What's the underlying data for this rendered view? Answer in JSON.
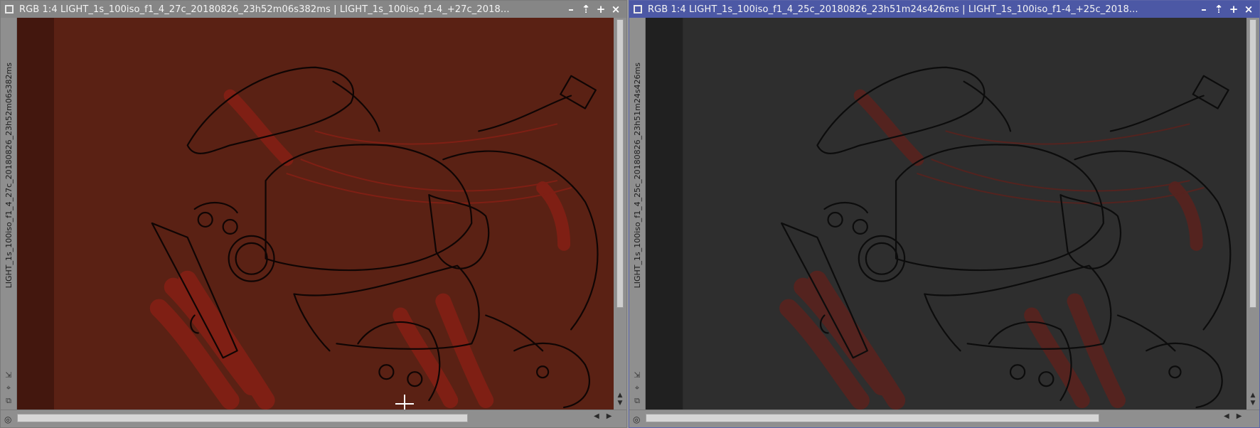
{
  "windows": [
    {
      "id": "left",
      "title": "RGB 1:4 LIGHT_1s_100iso_f1_4_27c_20180826_23h52m06s382ms | LIGHT_1s_100iso_f1-4_+27c_2018...",
      "vertical_label": "LIGHT_1s_100iso_f1_4_27c_20180826_23h52m06s382ms",
      "active": false,
      "tint": "#5a2114",
      "line_color": "#0f0504",
      "marker_color": "#8c1f14"
    },
    {
      "id": "right",
      "title": "RGB 1:4 LIGHT_1s_100iso_f1_4_25c_20180826_23h51m24s426ms | LIGHT_1s_100iso_f1-4_+25c_2018...",
      "vertical_label": "LIGHT_1s_100iso_f1_4_25c_20180826_23h51m24s426ms",
      "active": true,
      "tint": "#2e2e2e",
      "line_color": "#0c0c0c",
      "marker_color": "#6e1c16"
    }
  ],
  "controls": {
    "minimize": "–",
    "shade": "⇡",
    "maximize": "+",
    "close": "×"
  },
  "side_icons": [
    "⇲",
    "⌖",
    "⧉",
    "◎"
  ],
  "colors": {
    "active_titlebar": "#4c58a5",
    "inactive_titlebar": "#868686"
  }
}
